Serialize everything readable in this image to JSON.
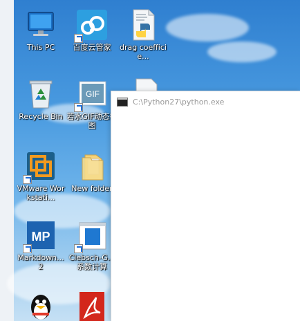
{
  "desktop": {
    "icons": [
      {
        "label": "This PC"
      },
      {
        "label": "百度云管家"
      },
      {
        "label": "drag coefficie..."
      },
      {
        "label": "Recycle Bin"
      },
      {
        "label": "若水GIF动态截图"
      },
      {
        "label": "VMware Workstati..."
      },
      {
        "label": "New folder"
      },
      {
        "label": "Markdown... 2"
      },
      {
        "label": "Clebsch-G... 系数计算"
      }
    ]
  },
  "console": {
    "title": "C:\\Python27\\python.exe"
  },
  "gif_icon_text": "GIF",
  "mp_icon_text": "MP"
}
